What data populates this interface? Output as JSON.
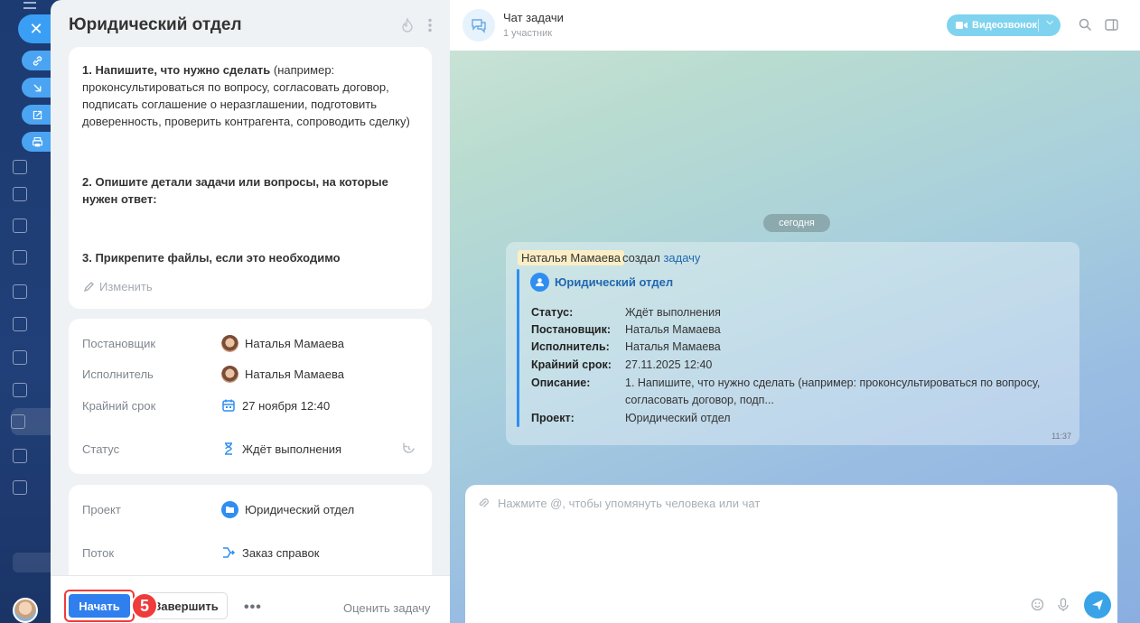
{
  "task": {
    "title": "Юридический отдел",
    "description": {
      "p1_bold": "1. Напишите, что нужно сделать",
      "p1_rest": " (например: проконсультироваться по вопросу, согласовать договор, подписать соглашение о неразглашении, подготовить доверенность, проверить контрагента, сопроводить сделку)",
      "p2_bold": "2. Опишите детали задачи или вопросы, на которые нужен ответ:",
      "p3_bold": "3. Прикрепите файлы, если это необходимо"
    },
    "edit_label": "Изменить",
    "fields": {
      "creator_label": "Постановщик",
      "creator_value": "Наталья Мамаева",
      "assignee_label": "Исполнитель",
      "assignee_value": "Наталья Мамаева",
      "deadline_label": "Крайний срок",
      "deadline_value": "27 ноября 12:40",
      "status_label": "Статус",
      "status_value": "Ждёт выполнения",
      "project_label": "Проект",
      "project_value": "Юридический отдел",
      "flow_label": "Поток",
      "flow_value": "Заказ справок"
    },
    "footer": {
      "start_label": "Начать",
      "finish_label": "Завершить",
      "more_label": "•••",
      "rate_label": "Оценить задачу",
      "step_badge": "5"
    }
  },
  "chat": {
    "title": "Чат задачи",
    "subtitle": "1 участник",
    "videocall_label": "Видеозвонок",
    "date_divider": "сегодня",
    "message": {
      "author": "Наталья Мамаева",
      "action": "создал",
      "link": "задачу",
      "quote_title": "Юридический отдел",
      "rows": [
        {
          "k": "Статус:",
          "v": "Ждёт выполнения"
        },
        {
          "k": "Постановщик:",
          "v": "Наталья Мамаева"
        },
        {
          "k": "Исполнитель:",
          "v": "Наталья Мамаева"
        },
        {
          "k": "Крайний срок:",
          "v": "27.11.2025 12:40"
        },
        {
          "k": "Описание:",
          "v": "1. Напишите, что нужно сделать (например: проконсультироваться по вопросу, согласовать договор, подп..."
        },
        {
          "k": "Проект:",
          "v": "Юридический отдел"
        }
      ],
      "time": "11:37"
    },
    "input_placeholder": "Нажмите @, чтобы упомянуть человека или чат"
  },
  "colors": {
    "accent": "#2f7fee",
    "highlight": "#ef3b3b",
    "link": "#2067b0",
    "videocall": "#7fd3ef"
  },
  "icons": [
    "close-icon",
    "link-icon",
    "download-icon",
    "open-external-icon",
    "print-icon",
    "fire-icon",
    "kebab-icon",
    "pencil-icon",
    "calendar-icon",
    "hourglass-icon",
    "refresh-icon",
    "folder-icon",
    "flow-icon",
    "chat-icon",
    "video-icon",
    "search-icon",
    "panel-icon",
    "paperclip-icon",
    "smile-icon",
    "mic-icon",
    "send-icon"
  ]
}
